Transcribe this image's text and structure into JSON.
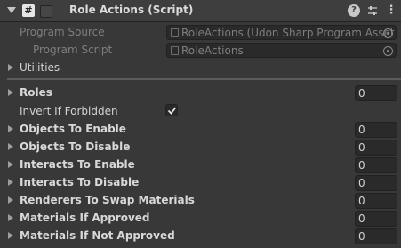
{
  "component": {
    "title": "Role Actions (Script)",
    "icon": "csharp-script-icon"
  },
  "fields": {
    "program_source_label": "Program Source",
    "program_source_value": "RoleActions (Udon Sharp Program Asset",
    "program_script_label": "Program Script",
    "program_script_value": "RoleActions",
    "utilities_label": "Utilities"
  },
  "properties": [
    {
      "label": "Roles",
      "value": "0"
    },
    {
      "label": "Invert If Forbidden",
      "checked": true
    },
    {
      "label": "Objects To Enable",
      "value": "0"
    },
    {
      "label": "Objects To Disable",
      "value": "0"
    },
    {
      "label": "Interacts To Enable",
      "value": "0"
    },
    {
      "label": "Interacts To Disable",
      "value": "0"
    },
    {
      "label": "Renderers To Swap Materials",
      "value": "0"
    },
    {
      "label": "Materials If Approved",
      "value": "0"
    },
    {
      "label": "Materials If Not Approved",
      "value": "0"
    }
  ]
}
